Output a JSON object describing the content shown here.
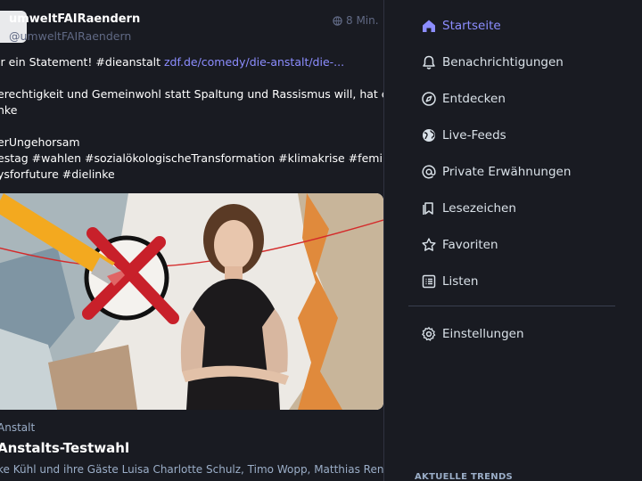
{
  "post": {
    "display_name": "umweltFAIRaendern",
    "handle": "@umweltFAIRaendern",
    "time": "8 Min.",
    "lines": [
      {
        "prefix": "ir ein Statement! #dieanstalt ",
        "link": "zdf.de/comedy/die-anstalt/die-..."
      },
      {
        "text": "erechtigkeit und Gemeinwohl statt Spaltung und Rassismus will, hat eine Wahl:"
      },
      {
        "text": "nke"
      },
      {
        "text": "erUngehorsam"
      },
      {
        "text": "estag #wahlen #sozialökologischeTransformation #klimakrise #feminismus"
      },
      {
        "text": "ysforfuture #dielinke"
      }
    ]
  },
  "card": {
    "provider": "Anstalt",
    "title": "Anstalts-Testwahl",
    "description": "ke Kühl und ihre Gäste Luisa Charlotte Schulz, Timo Wopp, Matthias Renger und ..."
  },
  "nav": {
    "items": [
      {
        "label": "Startseite",
        "icon": "home-icon",
        "active": true
      },
      {
        "label": "Benachrichtigungen",
        "icon": "bell-icon"
      },
      {
        "label": "Entdecken",
        "icon": "compass-icon"
      },
      {
        "label": "Live-Feeds",
        "icon": "globe-icon"
      },
      {
        "label": "Private Erwähnungen",
        "icon": "at-icon"
      },
      {
        "label": "Lesezeichen",
        "icon": "bookmark-icon"
      },
      {
        "label": "Favoriten",
        "icon": "star-icon"
      },
      {
        "label": "Listen",
        "icon": "list-icon"
      }
    ],
    "settings": {
      "label": "Einstellungen",
      "icon": "gear-icon"
    },
    "trends_heading": "AKTUELLE TRENDS"
  },
  "colors": {
    "background": "#191b22",
    "accent": "#8c8dff",
    "muted": "#606984",
    "nav_text": "#d9e1e8"
  }
}
